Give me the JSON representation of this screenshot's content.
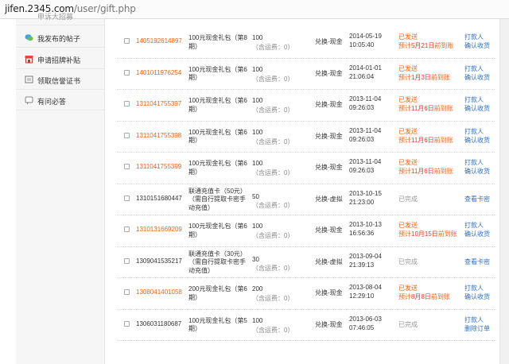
{
  "browser": {
    "url_host": "jifen.2345.com",
    "url_path": "/user/gift.php"
  },
  "sidebar": {
    "items": [
      {
        "label": "申诉大招募"
      },
      {
        "label": "我发布的帖子"
      },
      {
        "label": "申请招牌补贴"
      },
      {
        "label": "领取信誉证书"
      },
      {
        "label": "有问必答"
      }
    ]
  },
  "rows": [
    {
      "order": "1405192614897",
      "order_link": true,
      "name": "100元现金礼包（第8期）",
      "qty": "100",
      "fee": "（含运费：0）",
      "kind": "兑换-现金",
      "date": "2014-05-19",
      "time": "10:05:40",
      "status": "已发送",
      "status_color": "orange",
      "status2_pre": "预计",
      "status2_date": "5月21日",
      "status2_post": "前到账",
      "action1": "打款人",
      "action2": "确认收货"
    },
    {
      "order": "1401011976254",
      "order_link": true,
      "name": "100元现金礼包（第6期）",
      "qty": "100",
      "fee": "（含运费：0）",
      "kind": "兑换-现金",
      "date": "2014-01-01",
      "time": "21:06:04",
      "status": "已发送",
      "status_color": "orange",
      "status2_pre": "预计",
      "status2_date": "1月3日",
      "status2_post": "前到账",
      "action1": "打款人",
      "action2": "确认收货"
    },
    {
      "order": "1311041755397",
      "order_link": true,
      "name": "100元现金礼包（第6期）",
      "qty": "100",
      "fee": "（含运费：0）",
      "kind": "兑换-现金",
      "date": "2013-11-04",
      "time": "09:26:03",
      "status": "已发送",
      "status_color": "orange",
      "status2_pre": "预计",
      "status2_date": "11月6日",
      "status2_post": "前到账",
      "action1": "打款人",
      "action2": "确认收货"
    },
    {
      "order": "1311041755398",
      "order_link": true,
      "name": "100元现金礼包（第6期）",
      "qty": "100",
      "fee": "（含运费：0）",
      "kind": "兑换-现金",
      "date": "2013-11-04",
      "time": "09:26:03",
      "status": "已发送",
      "status_color": "orange",
      "status2_pre": "预计",
      "status2_date": "11月6日",
      "status2_post": "前到账",
      "action1": "打款人",
      "action2": "确认收货"
    },
    {
      "order": "1311041755399",
      "order_link": true,
      "name": "100元现金礼包（第6期）",
      "qty": "100",
      "fee": "（含运费：0）",
      "kind": "兑换-现金",
      "date": "2013-11-04",
      "time": "09:26:03",
      "status": "已发送",
      "status_color": "orange",
      "status2_pre": "预计",
      "status2_date": "11月6日",
      "status2_post": "前到账",
      "action1": "打款人",
      "action2": "确认收货"
    },
    {
      "order": "1310151680447",
      "order_link": false,
      "name": "联通充值卡（50元）（需自行提取卡密手动充值）",
      "qty": "50",
      "fee": "（含运费：0）",
      "kind": "兑换-虚拟",
      "date": "2013-10-15",
      "time": "21:23:00",
      "status": "已完成",
      "status_color": "grey",
      "status2_pre": "",
      "status2_date": "",
      "status2_post": "",
      "action1": "查看卡密",
      "action2": ""
    },
    {
      "order": "1310131669209",
      "order_link": true,
      "name": "100元现金礼包（第6期）",
      "qty": "100",
      "fee": "（含运费：0）",
      "kind": "兑换-现金",
      "date": "2013-10-13",
      "time": "16:56:36",
      "status": "已发送",
      "status_color": "orange",
      "status2_pre": "预计",
      "status2_date": "10月15日",
      "status2_post": "前到账",
      "action1": "打款人",
      "action2": "确认收货"
    },
    {
      "order": "1309041535217",
      "order_link": false,
      "name": "联通充值卡（30元）（需自行提取卡密手动充值）",
      "qty": "30",
      "fee": "（含运费：0）",
      "kind": "兑换-虚拟",
      "date": "2013-09-04",
      "time": "21:39:13",
      "status": "已完成",
      "status_color": "grey",
      "status2_pre": "",
      "status2_date": "",
      "status2_post": "",
      "action1": "查看卡密",
      "action2": ""
    },
    {
      "order": "1308041401058",
      "order_link": true,
      "name": "200元现金礼包（第6期）",
      "qty": "200",
      "fee": "（含运费：0）",
      "kind": "兑换-现金",
      "date": "2013-08-04",
      "time": "12:29:10",
      "status": "已发送",
      "status_color": "orange",
      "status2_pre": "预计",
      "status2_date": "8月8日",
      "status2_post": "前到账",
      "action1": "打款人",
      "action2": "确认收货"
    },
    {
      "order": "1306031180687",
      "order_link": false,
      "name": "100元现金礼包（第5期）",
      "qty": "100",
      "fee": "（含运费：0）",
      "kind": "兑换-现金",
      "date": "2013-06-03",
      "time": "07:46:05",
      "status": "已完成",
      "status_color": "grey",
      "status2_pre": "",
      "status2_date": "",
      "status2_post": "",
      "action1": "打款人",
      "action2": "删除订单"
    }
  ],
  "colors": {
    "orange": "#e8641b",
    "blue": "#2b6fc0",
    "grey": "#999999",
    "red": "#e23b2e"
  },
  "icons": [
    "chat-bubble-icon",
    "storefront-icon",
    "certificate-icon",
    "question-icon"
  ]
}
